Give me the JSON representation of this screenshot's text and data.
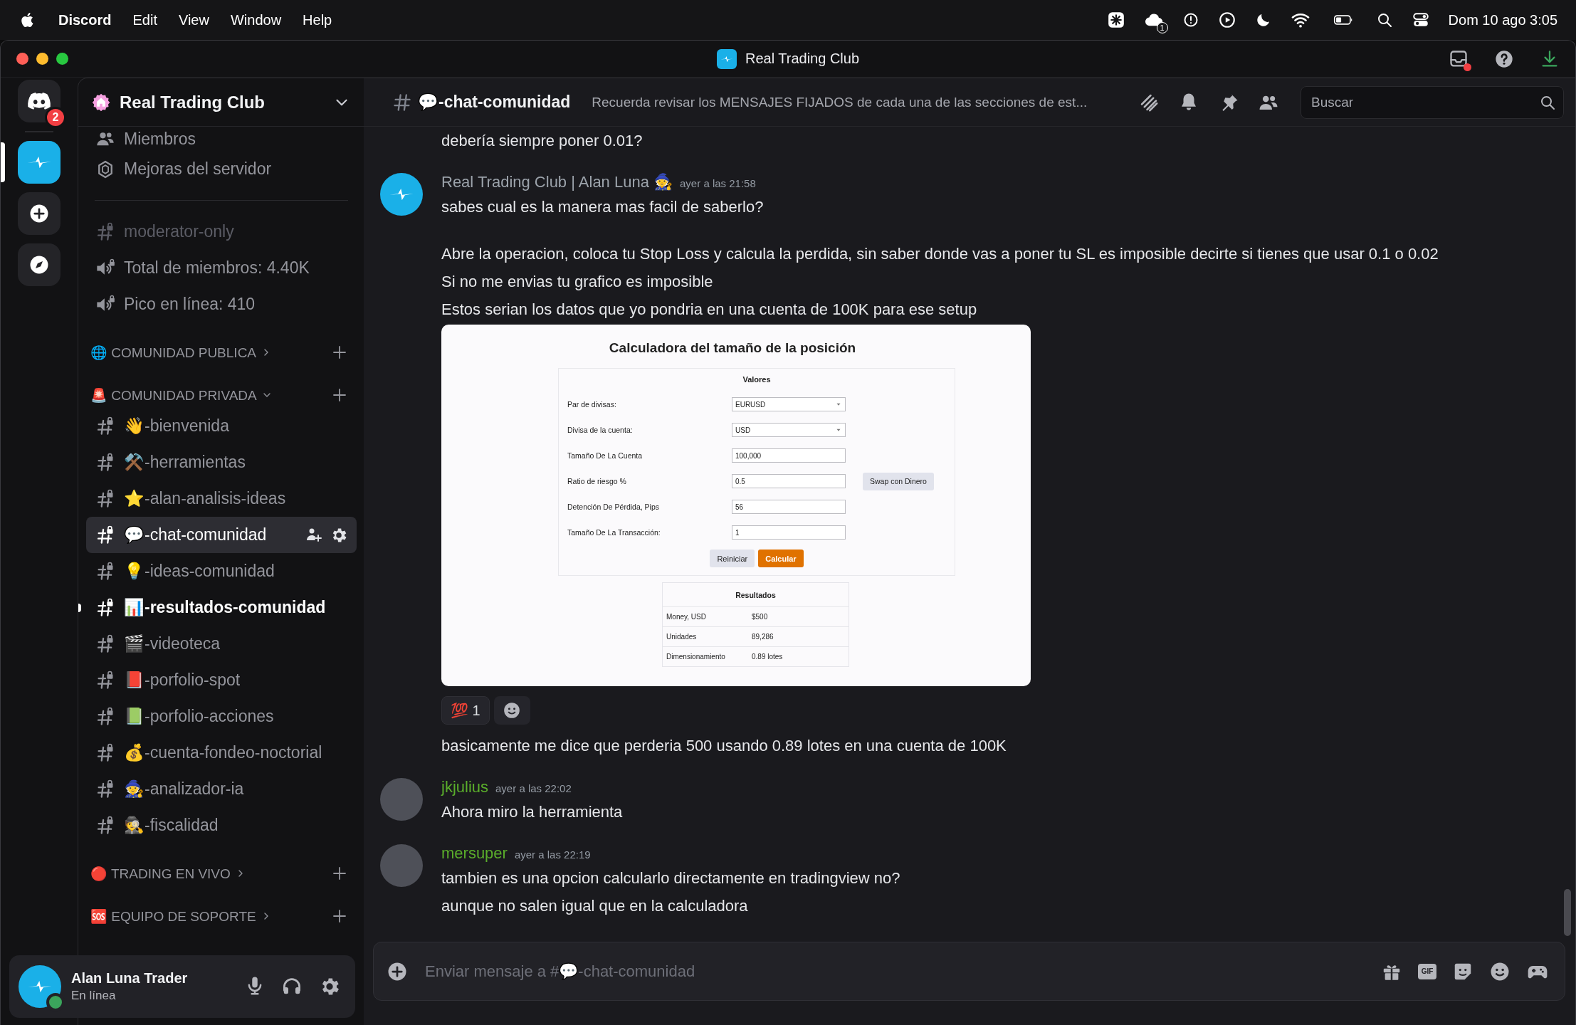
{
  "menubar": {
    "app": "Discord",
    "menus": [
      "Edit",
      "View",
      "Window",
      "Help"
    ],
    "notification_count": "1",
    "clock": "Dom 10 ago 3:05"
  },
  "window": {
    "title": "Real Trading Club",
    "inbox_unread": true
  },
  "servers": {
    "home_badge": "2",
    "items": [
      {
        "kind": "server",
        "selected": true
      },
      {
        "kind": "add"
      },
      {
        "kind": "discover"
      }
    ]
  },
  "server": {
    "name": "Real Trading Club"
  },
  "channels": [
    {
      "kind": "members",
      "name": "Miembros"
    },
    {
      "kind": "boosts",
      "name": "Mejoras del servidor"
    },
    {
      "kind": "divider"
    },
    {
      "kind": "text",
      "name": "moderator-only",
      "selected": false,
      "unread": false,
      "muted": true
    },
    {
      "kind": "voice",
      "name": "Total de miembros: 4.40K",
      "selected": false,
      "unread": false,
      "muted": false
    },
    {
      "kind": "voice",
      "name": "Pico en línea: 410",
      "selected": false,
      "unread": false,
      "muted": false
    },
    {
      "kind": "category",
      "name": "🌐 COMUNIDAD PUBLICA",
      "expanded": false
    },
    {
      "kind": "category",
      "name": "🚨 COMUNIDAD PRIVADA",
      "expanded": true
    },
    {
      "kind": "text",
      "name": "👋-bienvenida",
      "selected": false,
      "unread": false,
      "muted": false
    },
    {
      "kind": "text",
      "name": "⚒️-herramientas",
      "selected": false,
      "unread": false,
      "muted": false
    },
    {
      "kind": "text",
      "name": "⭐-alan-analisis-ideas",
      "selected": false,
      "unread": false,
      "muted": false
    },
    {
      "kind": "text",
      "name": "💬-chat-comunidad",
      "selected": true,
      "unread": false,
      "muted": false
    },
    {
      "kind": "text",
      "name": "💡-ideas-comunidad",
      "selected": false,
      "unread": false,
      "muted": false
    },
    {
      "kind": "text",
      "name": "📊-resultados-comunidad",
      "selected": false,
      "unread": true,
      "muted": false
    },
    {
      "kind": "text",
      "name": "🎬-videoteca",
      "selected": false,
      "unread": false,
      "muted": false
    },
    {
      "kind": "text",
      "name": "📕-porfolio-spot",
      "selected": false,
      "unread": false,
      "muted": false
    },
    {
      "kind": "text",
      "name": "📗-porfolio-acciones",
      "selected": false,
      "unread": false,
      "muted": false
    },
    {
      "kind": "text",
      "name": "💰-cuenta-fondeo-noctorial",
      "selected": false,
      "unread": false,
      "muted": false
    },
    {
      "kind": "text",
      "name": "🧙-analizador-ia",
      "selected": false,
      "unread": false,
      "muted": false
    },
    {
      "kind": "text",
      "name": "🕵️-fiscalidad",
      "selected": false,
      "unread": false,
      "muted": false
    },
    {
      "kind": "category",
      "name": "🔴 TRADING EN VIVO",
      "expanded": false
    },
    {
      "kind": "category",
      "name": "🆘 EQUIPO DE SOPORTE",
      "expanded": false
    }
  ],
  "chat_header": {
    "channel": "💬-chat-comunidad",
    "topic": "Recuerda revisar los MENSAJES FIJADOS de cada una de las secciones de est...",
    "search_placeholder": "Buscar"
  },
  "messages": [
    {
      "kind": "continuation",
      "blocks": [
        {
          "kind": "text",
          "text": "debería siempre poner 0.01?"
        }
      ]
    },
    {
      "kind": "full",
      "author": "Real Trading Club | Alan Luna 🧙",
      "color": "#9ca3ab",
      "time": "ayer a las 21:58",
      "avatar": {
        "kind": "brand"
      },
      "blocks": [
        {
          "kind": "text",
          "text": "sabes cual es la manera mas facil de saberlo?"
        },
        {
          "kind": "gap"
        },
        {
          "kind": "text",
          "text": "Abre la operacion, coloca tu Stop Loss y calcula la perdida, sin saber donde vas a poner tu SL es imposible decirte si tienes que usar 0.1 o 0.02"
        },
        {
          "kind": "text",
          "text": "Si no me envias tu grafico es imposible"
        },
        {
          "kind": "text",
          "text": "Estos serian los datos que yo pondria en una cuenta de 100K para ese setup"
        },
        {
          "kind": "calculator",
          "title": "Calculadora del tamaño de la posición",
          "section": "Valores",
          "fields": [
            {
              "label": "Par de divisas:",
              "value": "EURUSD",
              "kind": "select"
            },
            {
              "label": "Divisa de la cuenta:",
              "value": "USD",
              "kind": "select"
            },
            {
              "label": "Tamaño De La Cuenta",
              "value": "100,000",
              "kind": "input"
            },
            {
              "label": "Ratio de riesgo %",
              "value": "0.5",
              "kind": "input",
              "button": "Swap con Dinero"
            },
            {
              "label": "Detención De Pérdida, Pips",
              "value": "56",
              "kind": "input"
            },
            {
              "label": "Tamaño De La Transacción:",
              "value": "1",
              "kind": "input"
            }
          ],
          "actions": [
            {
              "label": "Reiniciar",
              "primary": false
            },
            {
              "label": "Calcular",
              "primary": true
            }
          ],
          "results_title": "Resultados",
          "results": [
            [
              "Money, USD",
              "$500"
            ],
            [
              "Unidades",
              "89,286"
            ],
            [
              "Dimensionamiento",
              "0.89 lotes"
            ]
          ]
        },
        {
          "kind": "reactions",
          "items": [
            {
              "emoji": "💯",
              "count": "1",
              "selected": false
            }
          ]
        },
        {
          "kind": "text",
          "text": "basicamente me dice que perderia 500 usando 0.89 lotes en una cuenta de 100K"
        }
      ]
    },
    {
      "kind": "full",
      "author": "jkjulius",
      "color": "#5aad2b",
      "time": "ayer a las 22:02",
      "avatar": {
        "kind": "plain"
      },
      "blocks": [
        {
          "kind": "text",
          "text": "Ahora miro la herramienta"
        }
      ]
    },
    {
      "kind": "full",
      "author": "mersuper",
      "color": "#5aad2b",
      "time": "ayer a las 22:19",
      "avatar": {
        "kind": "plain"
      },
      "blocks": [
        {
          "kind": "text",
          "text": "tambien es una opcion calcularlo directamente en tradingview no?"
        },
        {
          "kind": "text",
          "text": "aunque no salen igual que en la calculadora"
        }
      ]
    }
  ],
  "composer": {
    "placeholder": "Enviar mensaje a #💬-chat-comunidad",
    "gif_label": "GIF"
  },
  "user": {
    "name": "Alan Luna Trader",
    "status": "En línea",
    "online": true
  }
}
